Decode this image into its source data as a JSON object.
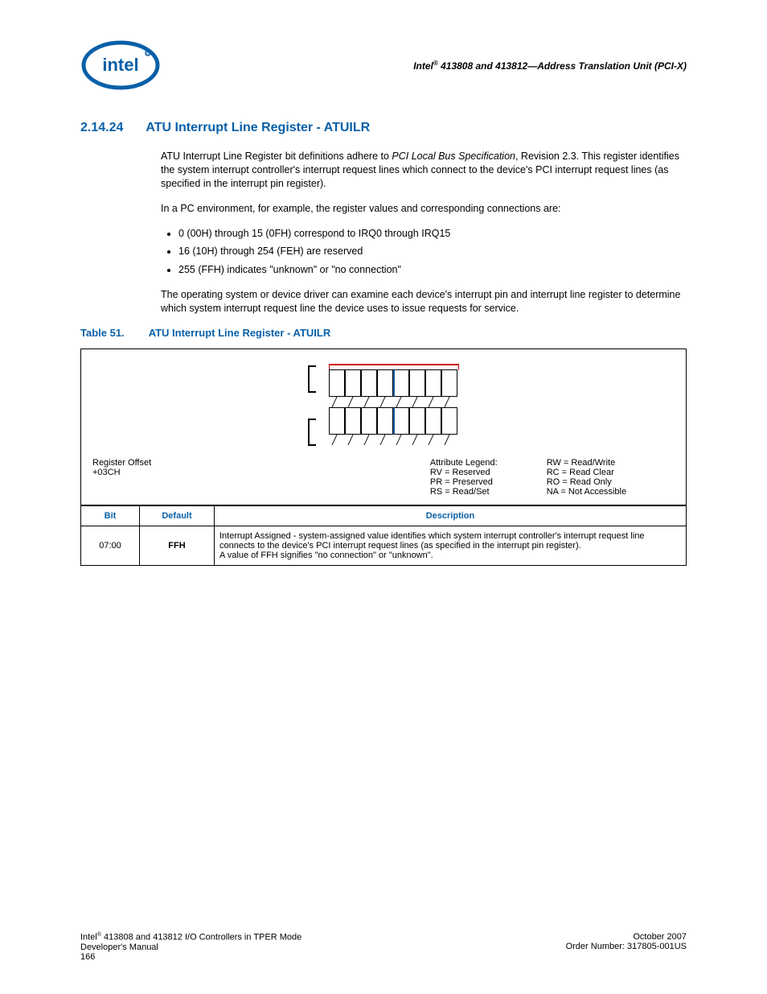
{
  "header": {
    "title_prefix": "Intel",
    "title_rest": " 413808 and 413812—Address Translation Unit (PCI-X)"
  },
  "section": {
    "number": "2.14.24",
    "title": "ATU Interrupt Line Register - ATUILR"
  },
  "body": {
    "p1_a": "ATU Interrupt Line Register bit definitions adhere to ",
    "p1_em": "PCI Local Bus Specification",
    "p1_b": ", Revision 2.3. This register identifies the system interrupt controller's interrupt request lines which connect to the device's PCI interrupt request lines (as specified in the interrupt pin register).",
    "p2": "In a PC environment, for example, the register values and corresponding connections are:",
    "li1": "0 (00H) through 15 (0FH) correspond to IRQ0 through IRQ15",
    "li2": "16 (10H) through 254 (FEH) are reserved",
    "li3": "255 (FFH) indicates \"unknown\" or \"no connection\"",
    "p3": "The operating system or device driver can examine each device's interrupt pin and interrupt line register to determine which system interrupt request line the device uses to issue requests for service."
  },
  "table_caption": {
    "label": "Table 51.",
    "title": "ATU Interrupt Line Register - ATUILR"
  },
  "figure": {
    "register_offset_label": "Register Offset",
    "register_offset_value": "+03CH",
    "legend_title": "Attribute Legend:",
    "legend_left": {
      "rv": "RV = Reserved",
      "pr": "PR = Preserved",
      "rs": "RS = Read/Set"
    },
    "legend_right": {
      "rw": "RW = Read/Write",
      "rc": "RC = Read Clear",
      "ro": "RO = Read Only",
      "na": "NA = Not Accessible"
    }
  },
  "reg_table": {
    "headers": {
      "bit": "Bit",
      "default": "Default",
      "desc": "Description"
    },
    "rows": [
      {
        "bit": "07:00",
        "default": "FFH",
        "desc_l1": "Interrupt Assigned - system-assigned value identifies which system interrupt controller's interrupt request line connects to the device's PCI interrupt request lines (as specified in the interrupt pin register).",
        "desc_l2": "A value of FFH signifies \"no connection\" or \"unknown\"."
      }
    ]
  },
  "footer": {
    "left_l1_a": "Intel",
    "left_l1_b": " 413808 and 413812 I/O Controllers in TPER Mode",
    "left_l2": "Developer's Manual",
    "left_l3": "166",
    "right_l1": "October 2007",
    "right_l2": "Order Number: 317805-001US"
  }
}
